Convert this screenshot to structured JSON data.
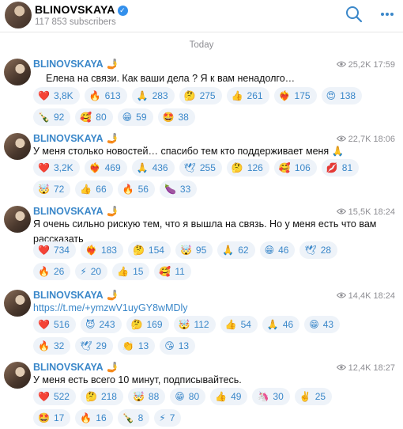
{
  "header": {
    "channel_name": "BLINOVSKAYA",
    "subscribers": "117 853 subscribers"
  },
  "date_divider": "Today",
  "posts": [
    {
      "author": "BLINOVSKAYA",
      "author_emoji": "🤳",
      "views": "25,2K",
      "time": "17:59",
      "text": "Елена на связи. Как ваши дела ? Я к вам ненадолго…",
      "reactions": [
        {
          "emoji": "❤️",
          "count": "3,8K"
        },
        {
          "emoji": "🔥",
          "count": "613"
        },
        {
          "emoji": "🙏",
          "count": "283"
        },
        {
          "emoji": "🤔",
          "count": "275"
        },
        {
          "emoji": "👍",
          "count": "261"
        },
        {
          "emoji": "❤️‍🔥",
          "count": "175"
        },
        {
          "emoji": "😍",
          "count": "138"
        },
        {
          "emoji": "🍾",
          "count": "92"
        },
        {
          "emoji": "🥰",
          "count": "80"
        },
        {
          "emoji": "😁",
          "count": "59"
        },
        {
          "emoji": "🤩",
          "count": "38"
        }
      ]
    },
    {
      "author": "BLINOVSKAYA",
      "author_emoji": "🤳",
      "views": "22,7K",
      "time": "18:06",
      "text": "У меня столько новостей… спасибо тем кто поддерживает меня 🙏",
      "reactions": [
        {
          "emoji": "❤️",
          "count": "3,2K"
        },
        {
          "emoji": "❤️‍🔥",
          "count": "469"
        },
        {
          "emoji": "🙏",
          "count": "436"
        },
        {
          "emoji": "🕊",
          "count": "255"
        },
        {
          "emoji": "🤔",
          "count": "126"
        },
        {
          "emoji": "🥰",
          "count": "106"
        },
        {
          "emoji": "💋",
          "count": "81"
        },
        {
          "emoji": "🤯",
          "count": "72"
        },
        {
          "emoji": "👍",
          "count": "66"
        },
        {
          "emoji": "🔥",
          "count": "56"
        },
        {
          "emoji": "🍆",
          "count": "33"
        }
      ]
    },
    {
      "author": "BLINOVSKAYA",
      "author_emoji": "🤳",
      "views": "15,5K",
      "time": "18:24",
      "text": "Я очень сильно рискую тем, что я вышла на связь. Но у меня есть что вам рассказать",
      "reactions": [
        {
          "emoji": "❤️",
          "count": "734"
        },
        {
          "emoji": "❤️‍🔥",
          "count": "183"
        },
        {
          "emoji": "🤔",
          "count": "154"
        },
        {
          "emoji": "🤯",
          "count": "95"
        },
        {
          "emoji": "🙏",
          "count": "62"
        },
        {
          "emoji": "😁",
          "count": "46"
        },
        {
          "emoji": "🕊",
          "count": "28"
        },
        {
          "emoji": "🔥",
          "count": "26"
        },
        {
          "emoji": "⚡",
          "count": "20"
        },
        {
          "emoji": "👍",
          "count": "15"
        },
        {
          "emoji": "🥰",
          "count": "11"
        }
      ]
    },
    {
      "author": "BLINOVSKAYA",
      "author_emoji": "🤳",
      "views": "14,4K",
      "time": "18:24",
      "text": "https://t.me/+ymzwV1uyGY8wMDly",
      "reactions": [
        {
          "emoji": "❤️",
          "count": "516"
        },
        {
          "emoji": "😈",
          "count": "243"
        },
        {
          "emoji": "🤔",
          "count": "169"
        },
        {
          "emoji": "🤯",
          "count": "112"
        },
        {
          "emoji": "👍",
          "count": "54"
        },
        {
          "emoji": "🙏",
          "count": "46"
        },
        {
          "emoji": "😁",
          "count": "43"
        },
        {
          "emoji": "🔥",
          "count": "32"
        },
        {
          "emoji": "🕊",
          "count": "29"
        },
        {
          "emoji": "👏",
          "count": "13"
        },
        {
          "emoji": "😘",
          "count": "13"
        }
      ]
    },
    {
      "author": "BLINOVSKAYA",
      "author_emoji": "🤳",
      "views": "12,4K",
      "time": "18:27",
      "text": "У меня есть всего 10 минут, подписывайтесь.",
      "reactions": [
        {
          "emoji": "❤️",
          "count": "522"
        },
        {
          "emoji": "🤔",
          "count": "218"
        },
        {
          "emoji": "🤯",
          "count": "88"
        },
        {
          "emoji": "😁",
          "count": "80"
        },
        {
          "emoji": "👍",
          "count": "49"
        },
        {
          "emoji": "🦄",
          "count": "30"
        },
        {
          "emoji": "✌️",
          "count": "25"
        },
        {
          "emoji": "🤩",
          "count": "17"
        },
        {
          "emoji": "🔥",
          "count": "16"
        },
        {
          "emoji": "🍾",
          "count": "8"
        },
        {
          "emoji": "⚡",
          "count": "7"
        }
      ]
    }
  ],
  "colors": {
    "accent": "#3a87c9",
    "muted": "#8e8e93",
    "chip_bg": "#eef3f9"
  }
}
